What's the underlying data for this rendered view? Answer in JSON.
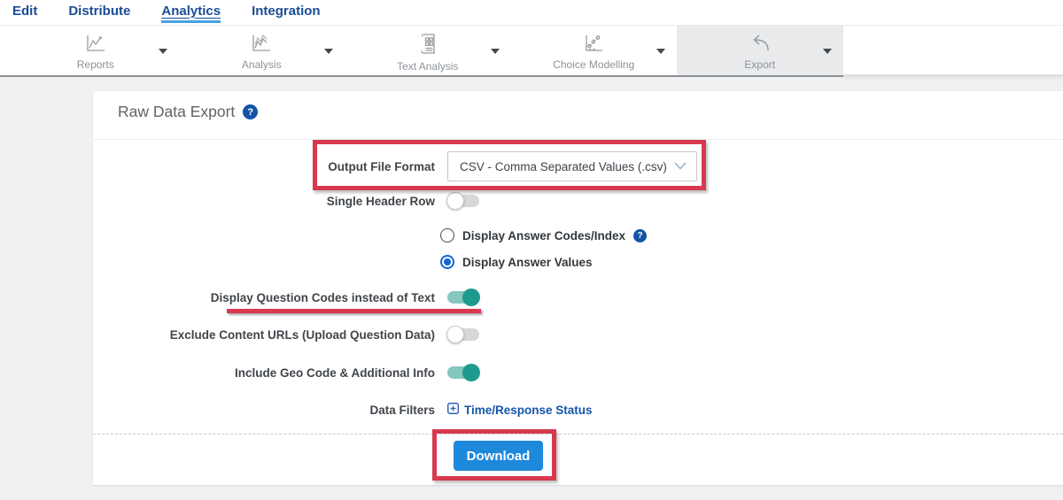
{
  "nav": {
    "items": [
      {
        "label": "Edit"
      },
      {
        "label": "Distribute"
      },
      {
        "label": "Analytics",
        "active": true
      },
      {
        "label": "Integration"
      }
    ]
  },
  "toolbar": {
    "items": [
      {
        "label": "Reports",
        "icon": "line-chart-icon"
      },
      {
        "label": "Analysis",
        "icon": "multi-line-chart-icon"
      },
      {
        "label": "Text Analysis",
        "icon": "document-report-icon"
      },
      {
        "label": "Choice Modelling",
        "icon": "dot-line-chart-icon"
      },
      {
        "label": "Export",
        "icon": "export-arrow-icon",
        "active": true
      }
    ]
  },
  "page": {
    "title": "Raw Data Export",
    "help_glyph": "?"
  },
  "form": {
    "output_file_format": {
      "label": "Output File Format",
      "value": "CSV - Comma Separated Values (.csv)"
    },
    "single_header_row": {
      "label": "Single Header Row",
      "state": "off"
    },
    "answer_display": {
      "options": [
        {
          "label": "Display Answer Codes/Index",
          "state": "unselected",
          "has_help": true
        },
        {
          "label": "Display Answer Values",
          "state": "selected"
        }
      ]
    },
    "question_codes": {
      "label": "Display Question Codes instead of Text",
      "state": "on"
    },
    "exclude_content_urls": {
      "label": "Exclude Content URLs (Upload Question Data)",
      "state": "off"
    },
    "include_geo": {
      "label": "Include Geo Code & Additional Info",
      "state": "on"
    },
    "data_filters": {
      "label": "Data Filters",
      "link_label": "Time/Response Status"
    }
  },
  "actions": {
    "download": "Download"
  },
  "colors": {
    "nav_blue": "#1a4c96",
    "link_blue": "#1456aa",
    "accent_blue": "#1e88da",
    "radio_blue": "#1565d8",
    "toggle_on_teal": "#1f9a8e",
    "toggle_track_teal": "#85c6bf",
    "annotation_red": "#d8394f",
    "help_badge_blue": "#1253a4"
  }
}
